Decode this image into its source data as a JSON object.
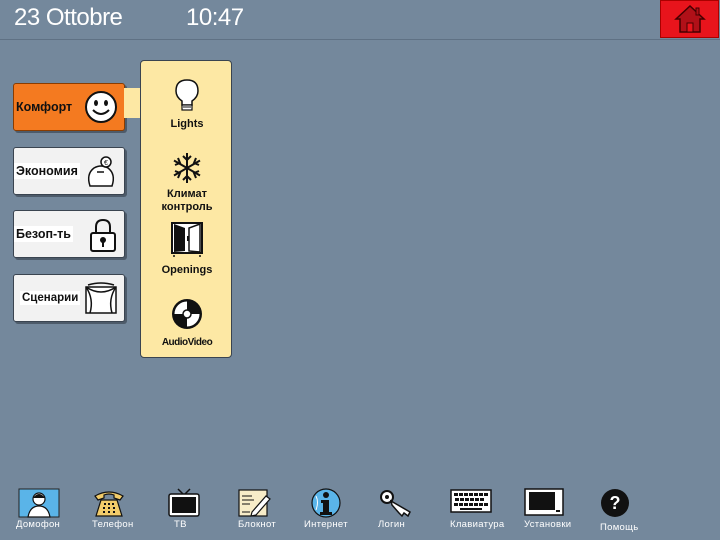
{
  "header": {
    "date": "23  Ottobre",
    "time": "10:47"
  },
  "categories": [
    {
      "id": "comfort",
      "label": "Комфорт",
      "icon": "smiley-icon",
      "selected": true
    },
    {
      "id": "economy",
      "label": "Экономия",
      "icon": "piggy-bank-icon"
    },
    {
      "id": "security",
      "label": "Безоп-ть",
      "icon": "padlock-icon"
    },
    {
      "id": "scenarios",
      "label": "Сценарии",
      "icon": "curtain-icon"
    }
  ],
  "submenu": {
    "lights": "Lights",
    "climate": "Климат контроль",
    "openings": "Openings",
    "av": "AudioVideo"
  },
  "dock": [
    {
      "label": "Домофон",
      "icon": "intercom-person-icon"
    },
    {
      "label": "Телефон",
      "icon": "telephone-icon"
    },
    {
      "label": "ТВ",
      "icon": "tv-icon"
    },
    {
      "label": "Блокнот",
      "icon": "notepad-icon"
    },
    {
      "label": "Интернет",
      "icon": "internet-info-icon"
    },
    {
      "label": "Логин",
      "icon": "key-icon"
    },
    {
      "label": "Клавиатура",
      "icon": "keyboard-icon"
    },
    {
      "label": "Установки",
      "icon": "monitor-settings-icon"
    },
    {
      "label": "Помощь",
      "icon": "help-question-icon"
    }
  ],
  "colors": {
    "background": "#74889c",
    "selected": "#f47a20",
    "panel": "#fde8a4",
    "home": "#e8141c"
  }
}
